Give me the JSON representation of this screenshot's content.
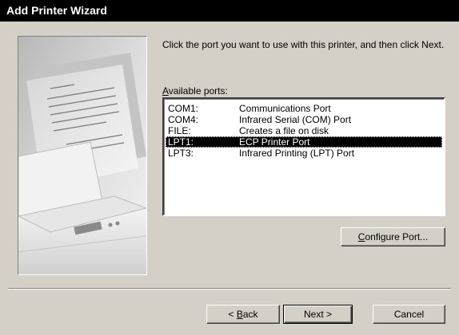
{
  "window": {
    "title": "Add Printer Wizard"
  },
  "instructions": "Click the port you want to use with this printer, and then click Next.",
  "ports_label": {
    "mnemonic": "A",
    "rest": "vailable ports:"
  },
  "ports": [
    {
      "port": "COM1:",
      "description": "Communications Port",
      "selected": false
    },
    {
      "port": "COM4:",
      "description": "Infrared Serial (COM) Port",
      "selected": false
    },
    {
      "port": "FILE:",
      "description": "Creates a file on disk",
      "selected": false
    },
    {
      "port": "LPT1:",
      "description": "ECP Printer Port",
      "selected": true
    },
    {
      "port": "LPT3:",
      "description": "Infrared Printing (LPT) Port",
      "selected": false
    }
  ],
  "buttons": {
    "configure": {
      "mnemonic": "C",
      "rest": "onfigure Port..."
    },
    "back": {
      "prefix": "< ",
      "mnemonic": "B",
      "rest": "ack"
    },
    "next": "Next >",
    "cancel": "Cancel"
  }
}
